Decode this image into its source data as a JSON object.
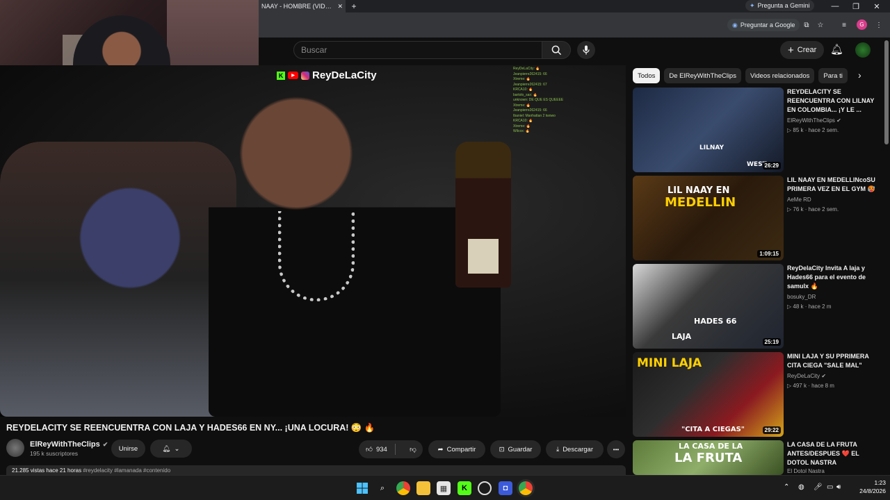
{
  "browser": {
    "tab_title": "NAAY - HOMBRE (VIDEO OF",
    "tab_close": "✕",
    "new_tab": "+",
    "gemini_label": "Pregunta a Gemini",
    "google_lens_label": "Preguntar a Google",
    "profile_initial": "G"
  },
  "youtube": {
    "search_placeholder": "Buscar",
    "create_label": "Crear",
    "video": {
      "watermark_name": "ReyDeLaCity",
      "chat_lines": [
        "ReyDeLaCity: 🔥",
        "Jeanpierre262415: 66",
        "Xtreme: 🔥",
        "Jeanpierre262415: 67",
        "KRCA10: 🔥",
        "bartolo_sax: 🔥",
        "unknown: DE QUE ES QUEEEE",
        "Xtreme: 🔥",
        "Jeanpierre262415: 66",
        "Ibaniel: Manhattan 2 twowo",
        "KRCA10: 🔥",
        "Xtreme: 🔥",
        "Wilcox: 🔥"
      ]
    },
    "title": "REYDELACITY SE REENCUENTRA CON LAJA Y HADES66 EN NY... ¡UNA LOCURA! 😳 🔥",
    "channel": {
      "name": "ElReyWithTheClips",
      "subscribers": "195 k suscriptores",
      "join_label": "Unirse"
    },
    "actions": {
      "likes": "934",
      "share": "Compartir",
      "save": "Guardar",
      "download": "Descargar",
      "more": "•••"
    },
    "description_preview": {
      "stats": "21.285 vistas  hace 21 horas",
      "tags": "#reydelacity #lamanada #contenido"
    },
    "chips": [
      "Todos",
      "De ElReyWithTheClips",
      "Videos relacionados",
      "Para ti"
    ],
    "recommendations": [
      {
        "title": "REYDELACITY SE REENCUENTRA CON LILNAY EN COLOMBIA... ¡Y LE ...",
        "channel": "ElReyWithTheClips",
        "verified": true,
        "views": "85 k",
        "age": "hace 2 sem.",
        "duration": "26:29",
        "thumb_text": [
          "LILNAY",
          "WEST"
        ]
      },
      {
        "title": "LIL NAAY EN MEDELLINcoSU PRIMERA VEZ EN EL GYM 🥵",
        "channel": "AeMe RD",
        "verified": false,
        "views": "76 k",
        "age": "hace 2 sem.",
        "duration": "1:09:15",
        "thumb_text": [
          "LIL NAAY EN",
          "MEDELLIN"
        ]
      },
      {
        "title": "ReyDelaCity Invita A laja y Hades66 para el evento de samulx 🔥",
        "channel": "bosuky_DR",
        "verified": false,
        "views": "48 k",
        "age": "hace 2 m",
        "duration": "25:19",
        "thumb_text": [
          "HADES 66",
          "LAJA"
        ]
      },
      {
        "title": "MINI LAJA Y SU PPRIMERA CITA CIEGA \"SALE MAL\"",
        "channel": "ReyDeLaCity",
        "verified": true,
        "views": "497 k",
        "age": "hace 8 m",
        "duration": "29:22",
        "thumb_text": [
          "MINI LAJA",
          "\"CITA A CIEGAS\""
        ]
      },
      {
        "title": "LA CASA DE LA FRUTA ANTES/DESPUES ❤️ EL DOTOL NASTRA",
        "channel": "El Dotol Nastra",
        "verified": false,
        "views": "",
        "age": "",
        "duration": "",
        "thumb_text": [
          "LA CASA DE LA",
          "LA FRUTA"
        ]
      }
    ]
  },
  "taskbar": {
    "time": "1:23",
    "date": "24/8/2026"
  },
  "colors": {
    "yt_bg": "#0f0f0f",
    "pill_bg": "#272727",
    "accent_red": "#ff0000",
    "kick_green": "#53fc18"
  }
}
